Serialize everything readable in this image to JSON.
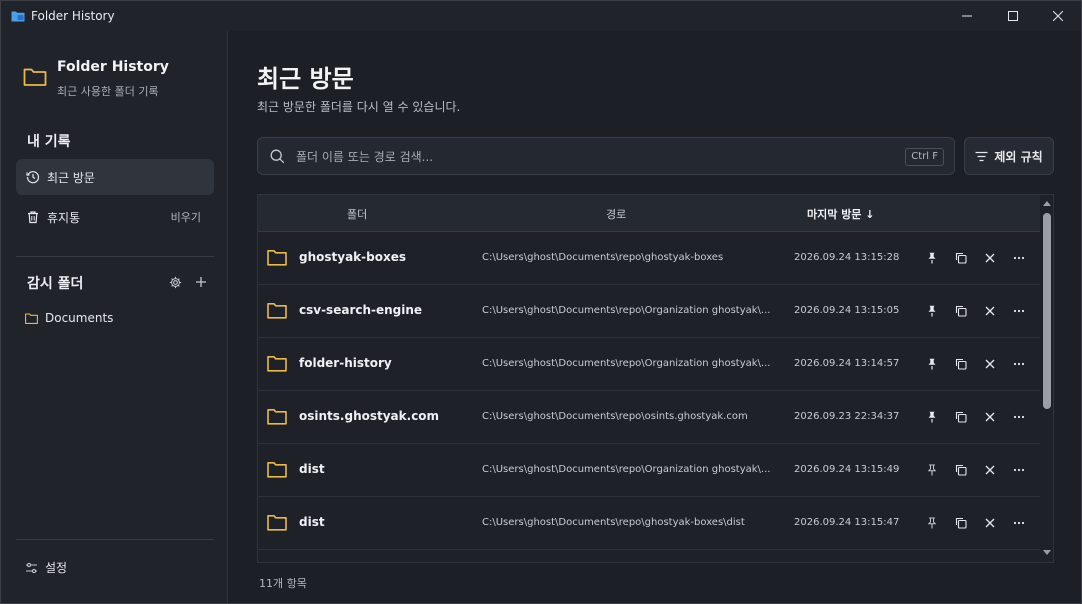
{
  "window": {
    "title": "Folder History"
  },
  "sidebar": {
    "brand_title": "Folder History",
    "brand_subtitle": "최근 사용한 폴더 기록",
    "my_records_title": "내 기록",
    "nav": [
      {
        "label": "최근 방문",
        "icon": "history-icon",
        "active": true
      },
      {
        "label": "휴지통",
        "icon": "trash-icon",
        "action": "비우기"
      }
    ],
    "watch_title": "감시 폴더",
    "watch_items": [
      {
        "label": "Documents",
        "icon": "folder-icon"
      }
    ],
    "settings_label": "설정"
  },
  "main": {
    "title": "최근 방문",
    "subtitle": "최근 방문한 폴더를 다시 열 수 있습니다.",
    "search": {
      "placeholder": "폴더 이름 또는 경로 검색...",
      "shortcut": "Ctrl F"
    },
    "filter_label": "제외 규칙",
    "columns": {
      "folder": "폴더",
      "path": "경로",
      "last_visit": "마지막 방문 ↓"
    },
    "rows": [
      {
        "name": "ghostyak-boxes",
        "path": "C:\\Users\\ghost\\Documents\\repo\\ghostyak-boxes",
        "date": "2026.09.24 13:15:28",
        "pinned": true
      },
      {
        "name": "csv-search-engine",
        "path": "C:\\Users\\ghost\\Documents\\repo\\Organization ghostyak\\...",
        "date": "2026.09.24 13:15:05",
        "pinned": true
      },
      {
        "name": "folder-history",
        "path": "C:\\Users\\ghost\\Documents\\repo\\Organization ghostyak\\...",
        "date": "2026.09.24 13:14:57",
        "pinned": true
      },
      {
        "name": "osints.ghostyak.com",
        "path": "C:\\Users\\ghost\\Documents\\repo\\osints.ghostyak.com",
        "date": "2026.09.23 22:34:37",
        "pinned": true
      },
      {
        "name": "dist",
        "path": "C:\\Users\\ghost\\Documents\\repo\\Organization ghostyak\\...",
        "date": "2026.09.24 13:15:49",
        "pinned": false
      },
      {
        "name": "dist",
        "path": "C:\\Users\\ghost\\Documents\\repo\\ghostyak-boxes\\dist",
        "date": "2026.09.24 13:15:47",
        "pinned": false
      }
    ],
    "item_count": "11개 항목"
  },
  "colors": {
    "folder": "#e9b949",
    "background": "#1c1f25",
    "sidebar": "#20232a",
    "active_nav": "#2f343d"
  }
}
